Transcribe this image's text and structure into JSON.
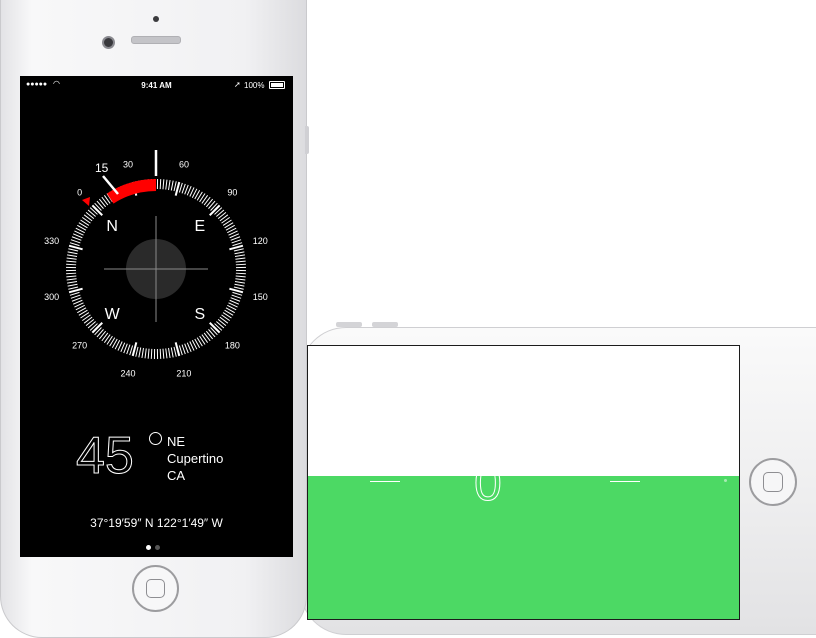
{
  "compass": {
    "status_bar": {
      "signal": "●●●●●",
      "wifi_icon": "wifi-icon",
      "time": "9:41 AM",
      "location_icon": "location-arrow-icon",
      "battery": "100%"
    },
    "dial_labels": {
      "degrees": [
        "0",
        "30",
        "60",
        "90",
        "120",
        "150",
        "180",
        "210",
        "240",
        "270",
        "300",
        "330"
      ],
      "cardinals": [
        "N",
        "E",
        "S",
        "W"
      ],
      "bearing_marker": "15"
    },
    "heading": {
      "degrees": "45",
      "direction": "NE",
      "city": "Cupertino",
      "state": "CA"
    },
    "coordinates": "37°19′59″ N  122°1′49″ W",
    "pages": {
      "count": 2,
      "active": 0
    }
  },
  "level": {
    "reading": "0",
    "fill_fraction": 0.53
  },
  "colors": {
    "level_green": "#4cd964",
    "heading_red": "#ff0000",
    "screen_black": "#000000"
  }
}
